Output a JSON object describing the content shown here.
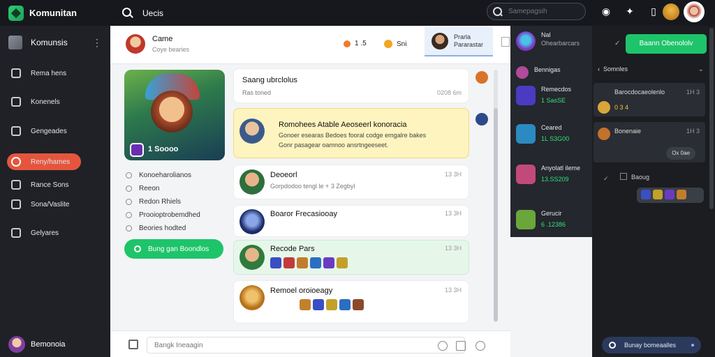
{
  "topbar": {
    "brand": "Komunitan",
    "query": "Uecis",
    "search_placeholder": "Samepagsih"
  },
  "sidebar": {
    "header": "Komunsis",
    "items": [
      {
        "label": "Rema hens",
        "icon": "home-icon"
      },
      {
        "label": "Konenels",
        "icon": "grid-icon"
      },
      {
        "label": "Gengeades",
        "icon": "profile-icon"
      },
      {
        "label": "Reny/hames",
        "icon": "users-icon",
        "active": true
      },
      {
        "label": "Rance Sons",
        "icon": "list-icon"
      },
      {
        "label": "Sona/Vaslite",
        "icon": "upload-icon"
      },
      {
        "label": "Gelyares",
        "icon": "star-icon"
      }
    ],
    "user_name": "Bemonoia"
  },
  "main_header": {
    "title": "Came",
    "subtitle": "Coye bearies",
    "stat1": "1 .5",
    "stat2": "Sni",
    "tab_title": "Prarla",
    "tab_sub": "Pararastar"
  },
  "hero": {
    "score": "1 Soooo"
  },
  "info_list": [
    {
      "text": "Konoeharolianos"
    },
    {
      "text": "Reeon"
    },
    {
      "text": "Redon Rhiels"
    },
    {
      "text": "Prooioptrobemdhed"
    },
    {
      "text": "Beories hodted"
    }
  ],
  "green_button": "Bung gan Boondlos",
  "feed": {
    "header_title": "Saang ubrclolus",
    "header_sub": "Ras toned",
    "header_time": "0208 6m",
    "highlight": {
      "title": "Romohees Atable Aeoseerl konoracia",
      "line1": "Gonoer esearas Bedoes fooral codge emgalre bakes",
      "line2": "Gonr pasagear oamnoo ansrtngeeseet."
    },
    "posts": [
      {
        "name": "Deoeorl",
        "sub": "Gorpdodoo tengl le + 3 Zegbyl",
        "time": "13 3H"
      },
      {
        "name": "Boaror Frecasiooay",
        "sub": "",
        "time": "13 3H"
      },
      {
        "name": "Recode Pars",
        "sub": "",
        "time": "13 3H"
      },
      {
        "name": "Remoel oroioeagy",
        "sub": "",
        "time": "13 3H"
      }
    ]
  },
  "composer": {
    "placeholder": "Bangk Ineaagin"
  },
  "overlay": {
    "items": [
      {
        "name": "Nal",
        "sub": "Ohearbarcars",
        "value": ""
      },
      {
        "name": "Bennigas",
        "sub": "",
        "value": ""
      },
      {
        "name": "Remecdos",
        "sub": "",
        "value": "1 SasSE"
      },
      {
        "name": "Ceared",
        "sub": "",
        "value": "1L S3G00"
      },
      {
        "name": "Anyolatl ileme",
        "sub": "",
        "value": "13.SS209"
      },
      {
        "name": "Gerucir",
        "sub": "",
        "value": "6 .12386"
      }
    ]
  },
  "right_panel": {
    "button": "Baann Obenololv",
    "section": "Somnles",
    "card1": {
      "name": "Barocdocaeolenlo",
      "time": "1H 3",
      "row": "0 3 4"
    },
    "card2": {
      "name": "Bonenaie",
      "time": "1H 3",
      "pill": "Ox 0ae"
    },
    "sub_label": "Baoug",
    "bottom_button": "Bunay bomeaalles"
  },
  "colors": {
    "accent_green": "#1ec46a",
    "active_red": "#e5553d",
    "value_green": "#2fe07a"
  }
}
